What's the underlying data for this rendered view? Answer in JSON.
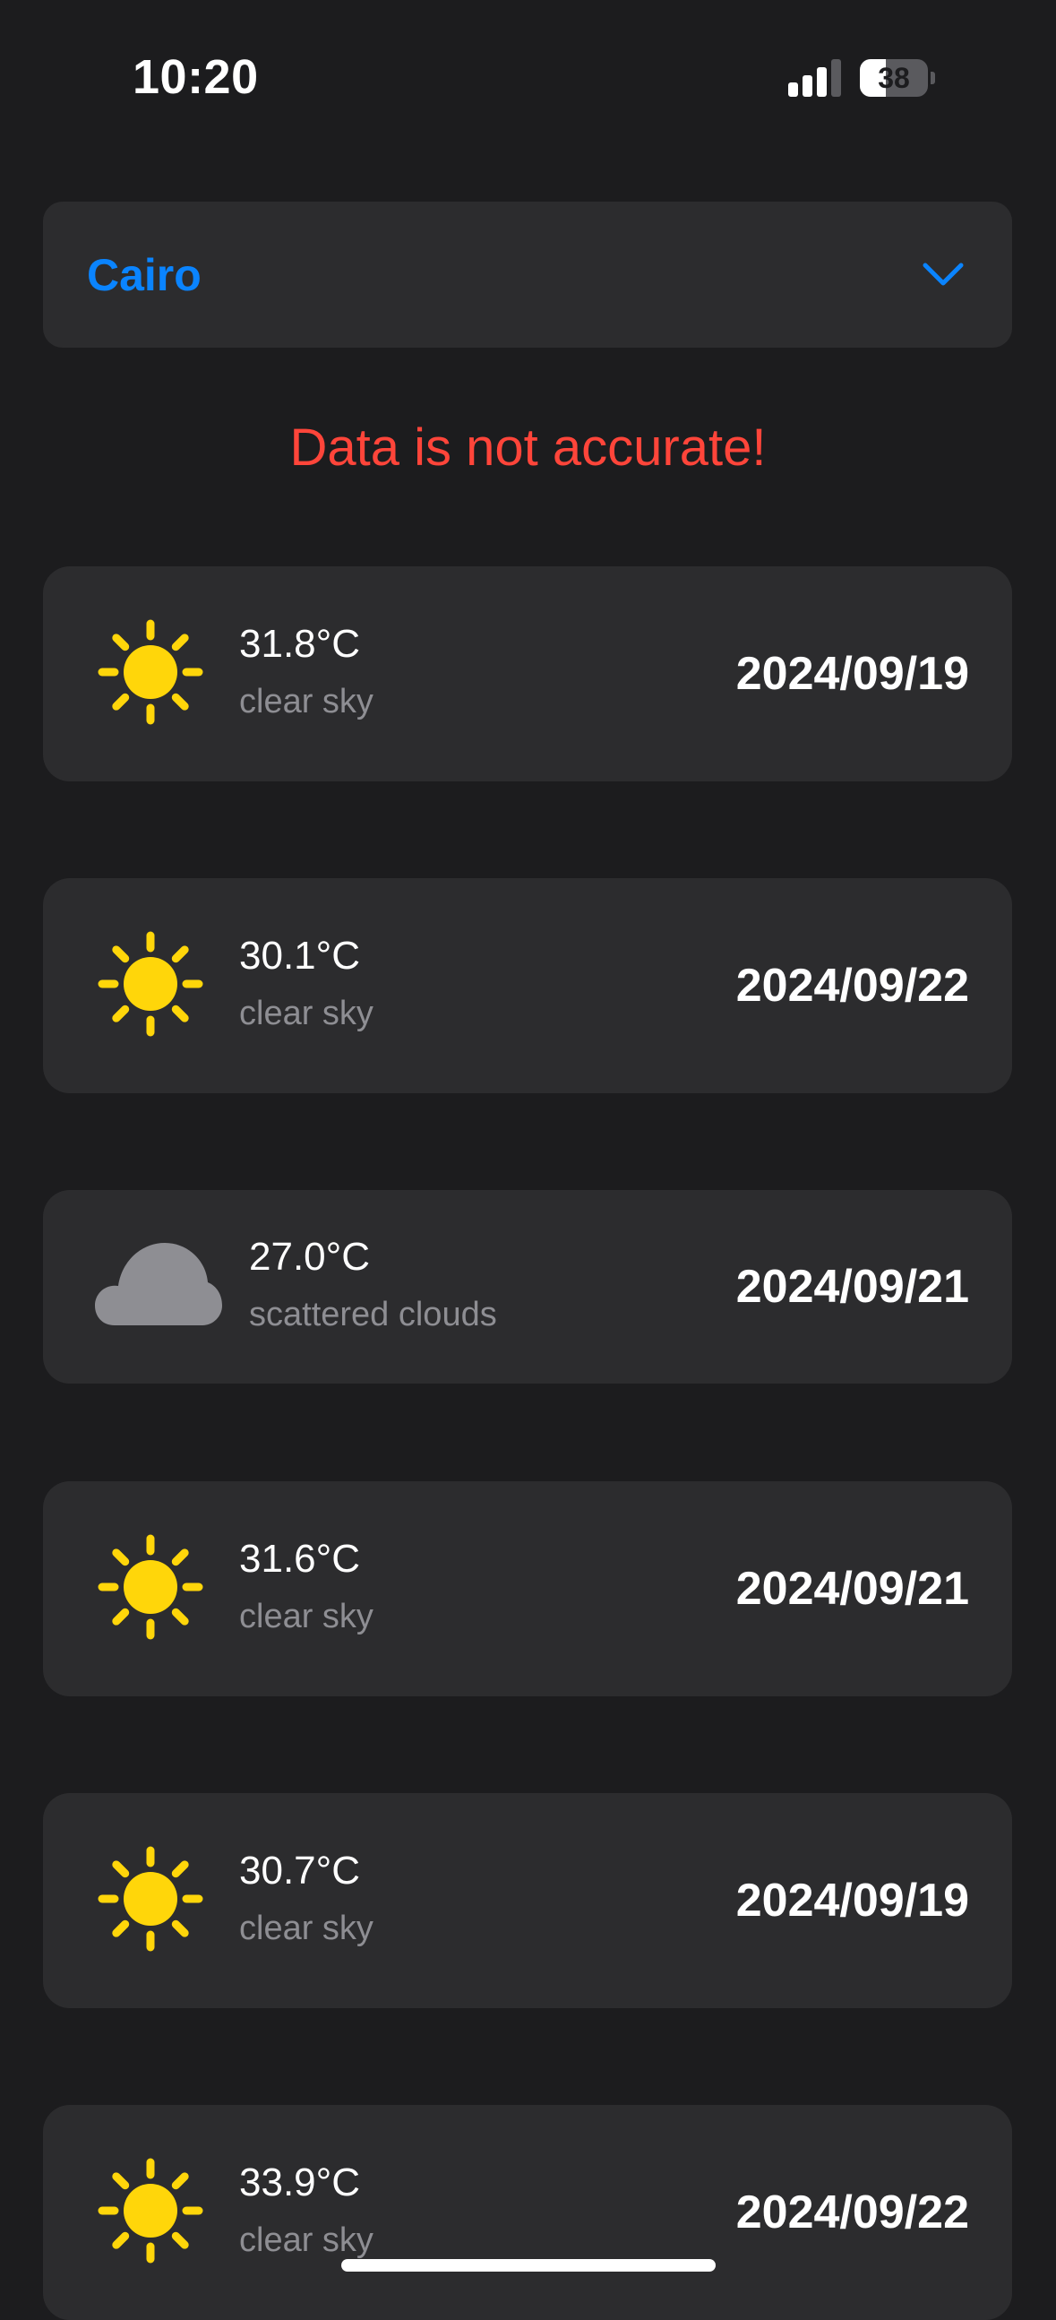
{
  "status_bar": {
    "time": "10:20",
    "battery_level": "38",
    "battery_fraction": 0.38,
    "signal_bars_active": 3,
    "signal_bars_total": 4
  },
  "city_picker": {
    "selected": "Cairo",
    "icon": "chevron-down-icon",
    "accent_color": "#0a84ff"
  },
  "warning": {
    "text": "Data is not accurate!",
    "color": "#ff453a"
  },
  "forecasts": [
    {
      "temp": "31.8°C",
      "desc": "clear sky",
      "date": "2024/09/19",
      "icon": "sun-icon"
    },
    {
      "temp": "30.1°C",
      "desc": "clear sky",
      "date": "2024/09/22",
      "icon": "sun-icon"
    },
    {
      "temp": "27.0°C",
      "desc": "scattered clouds",
      "date": "2024/09/21",
      "icon": "cloud-icon"
    },
    {
      "temp": "31.6°C",
      "desc": "clear sky",
      "date": "2024/09/21",
      "icon": "sun-icon"
    },
    {
      "temp": "30.7°C",
      "desc": "clear sky",
      "date": "2024/09/19",
      "icon": "sun-icon"
    },
    {
      "temp": "33.9°C",
      "desc": "clear sky",
      "date": "2024/09/22",
      "icon": "sun-icon"
    }
  ],
  "colors": {
    "background": "#1c1c1e",
    "card": "#2c2c2e",
    "sun": "#ffd60a",
    "cloud": "#8e8e93"
  }
}
